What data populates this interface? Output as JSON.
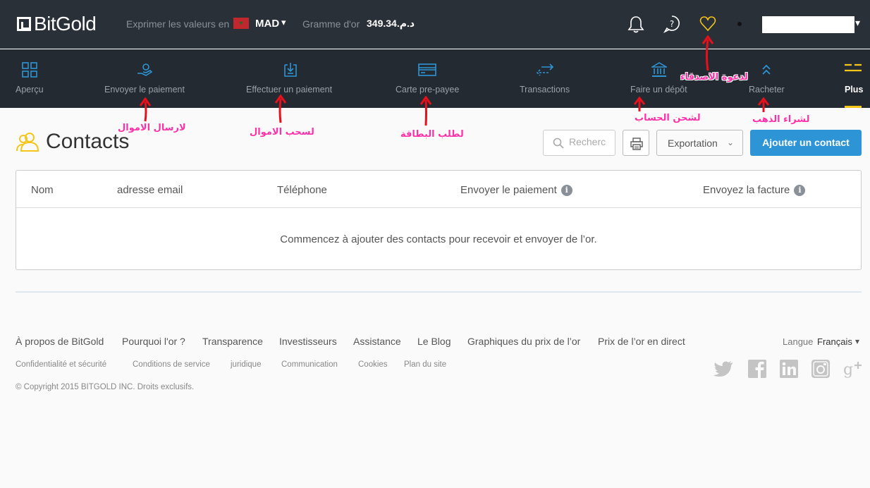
{
  "brand": {
    "name": "BitGold"
  },
  "topbar": {
    "express_label": "Exprimer les valeurs en",
    "flag_glyph": "✶",
    "currency": "MAD",
    "gram_label": "Gramme d'or",
    "gram_value": "349.34.د.م"
  },
  "nav": {
    "items": [
      {
        "label": "Aperçu",
        "icon": "grid-icon"
      },
      {
        "label": "Envoyer le paiement",
        "icon": "send-payment-icon"
      },
      {
        "label": "Effectuer un paiement",
        "icon": "make-payment-icon"
      },
      {
        "label": "Carte pre-payee",
        "icon": "card-icon"
      },
      {
        "label": "Transactions",
        "icon": "transfer-arrows-icon"
      },
      {
        "label": "Faire un dépôt",
        "icon": "bank-icon"
      },
      {
        "label": "Racheter",
        "icon": "double-chevron-up-icon"
      },
      {
        "label": "Plus",
        "icon": "menu-lines-icon"
      }
    ]
  },
  "page": {
    "title": "Contacts",
    "search_placeholder": "Recherc",
    "export_label": "Exportation",
    "add_label": "Ajouter un contact"
  },
  "table": {
    "columns": [
      "Nom",
      "adresse email",
      "Téléphone",
      "Envoyer le paiement",
      "Envoyez la facture"
    ],
    "info_glyph": "i",
    "empty_message": "Commencez à ajouter des contacts pour recevoir et envoyer de l’or."
  },
  "footer": {
    "links": [
      "À propos de BitGold",
      "Pourquoi l'or ?",
      "Transparence",
      "Investisseurs",
      "Assistance",
      "Le Blog",
      "Graphiques du prix de l’or",
      "Prix de l’or en direct"
    ],
    "sub_links": [
      "Confidentialité et sécurité",
      "Conditions de service",
      "juridique",
      "Communication",
      "Cookies",
      "Plan du site"
    ],
    "copyright": "© Copyright 2015 BITGOLD INC. Droits exclusifs.",
    "language_label": "Langue",
    "language_value": "Français",
    "social": [
      "twitter-icon",
      "facebook-icon",
      "linkedin-icon",
      "instagram-icon",
      "google-plus-icon"
    ]
  },
  "annotations": {
    "send": "لارسال الاموال",
    "withdraw": "لسحب الاموال",
    "card": "لطلب البطاقة",
    "deposit": "لشحن الحساب",
    "invite": "لدعوة الاصدقاء",
    "buy": "لشراء الذهب"
  },
  "colors": {
    "accent_blue": "#2d95d6",
    "gold": "#f5c518",
    "annotation_pink": "#ff2fa8",
    "arrow_red": "#e8101a",
    "topbar_bg": "#2a3038",
    "navbar_bg": "#242a31"
  }
}
